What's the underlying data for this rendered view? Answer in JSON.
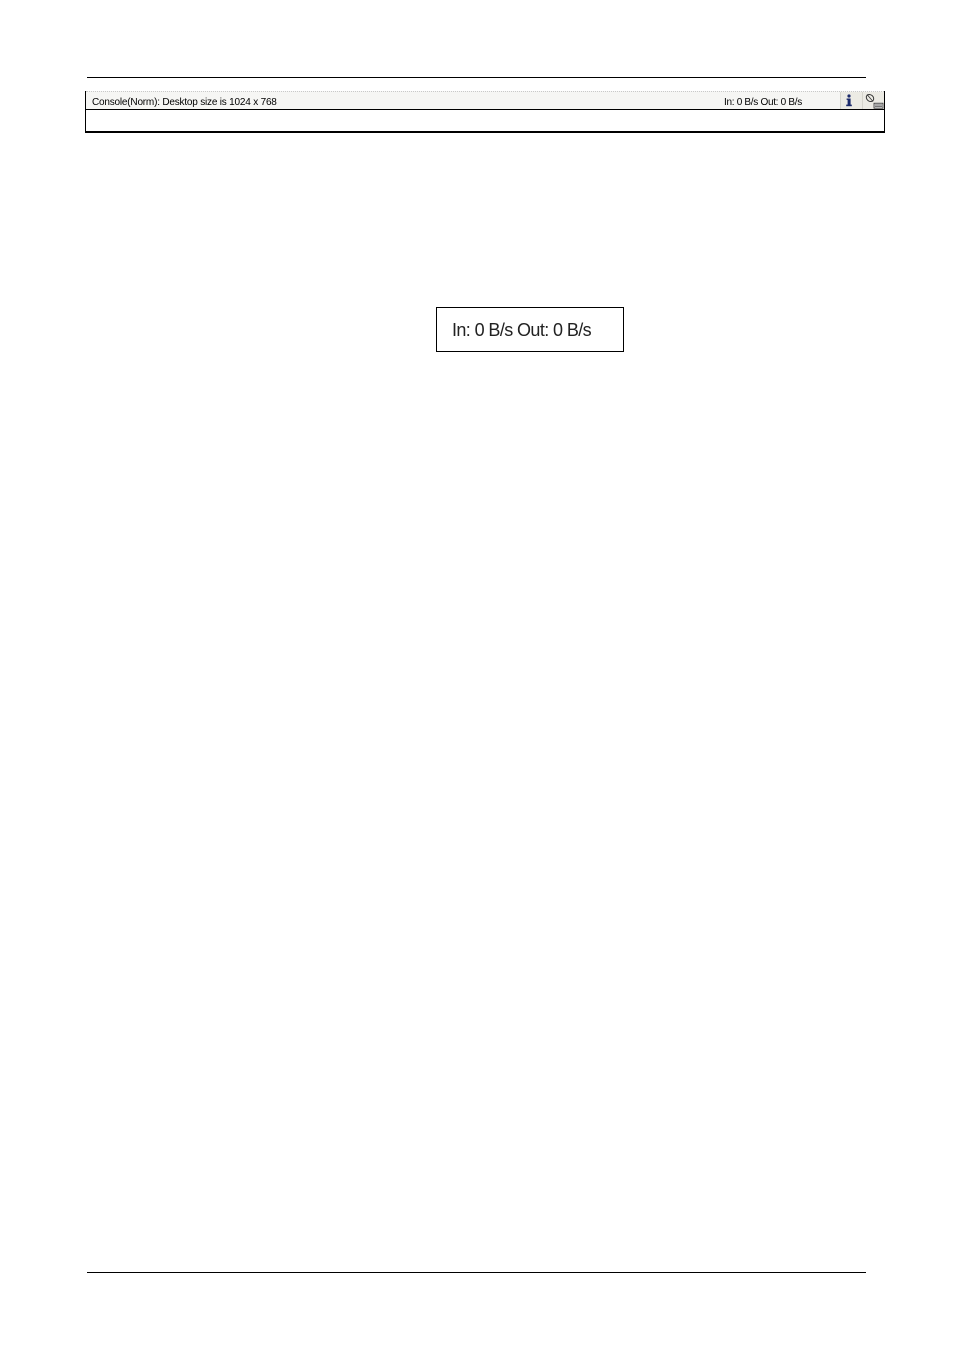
{
  "status_bar": {
    "left_text": "Console(Norm): Desktop size is 1024 x 768",
    "right_text": "In: 0 B/s Out: 0 B/s",
    "icons": [
      "info-icon",
      "network-connection-icon"
    ]
  },
  "zoom_callout": {
    "text": "In: 0 B/s Out: 0 B/s"
  }
}
